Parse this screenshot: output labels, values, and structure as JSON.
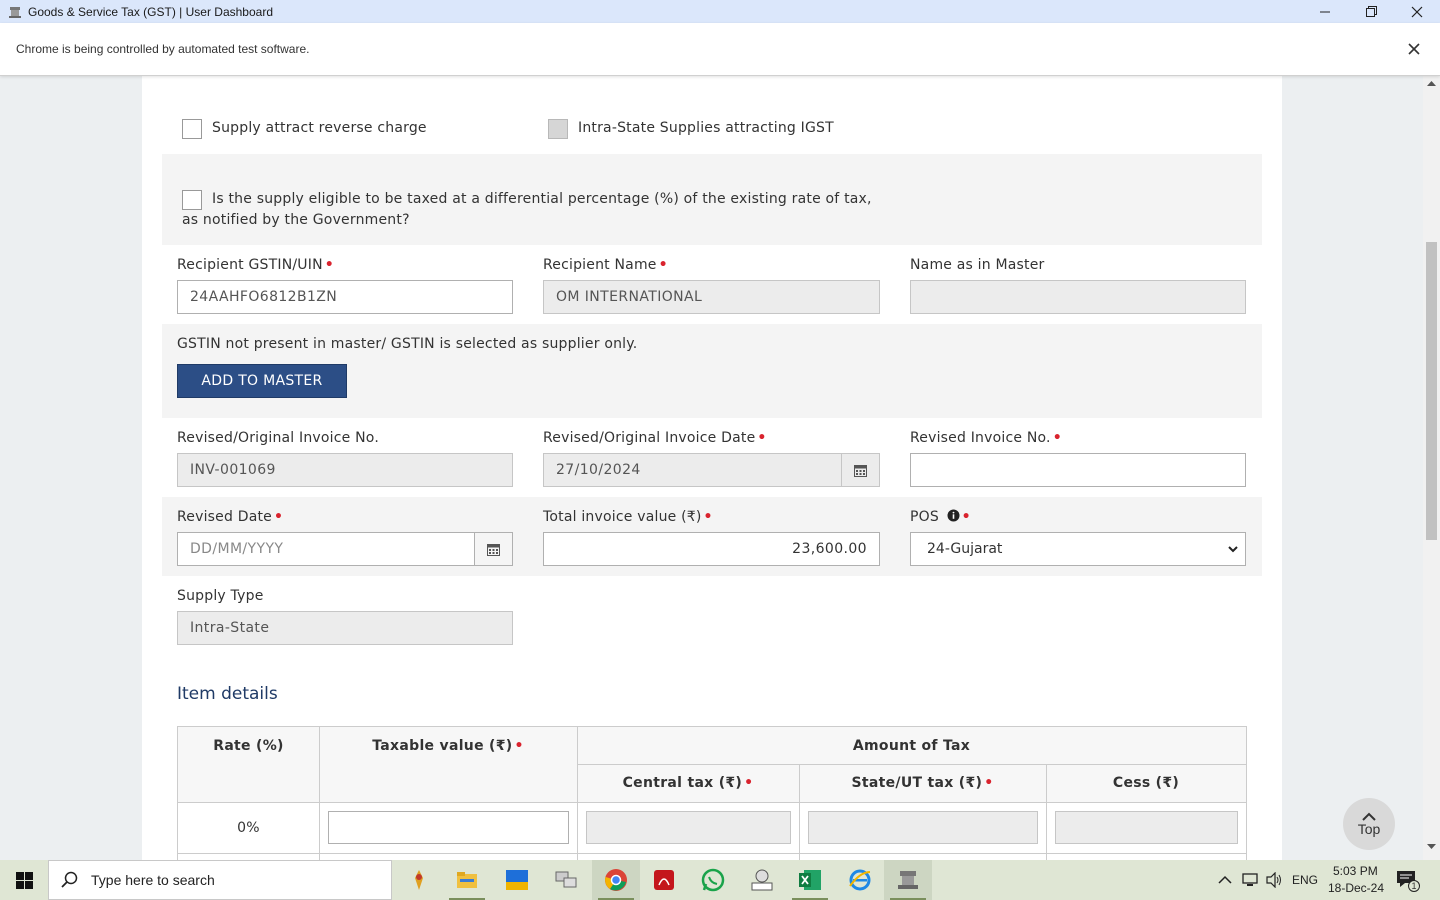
{
  "window": {
    "title": "Goods & Service Tax (GST) | User Dashboard"
  },
  "infobar": {
    "message": "Chrome is being controlled by automated test software."
  },
  "form": {
    "reverse_charge_label": "Supply attract reverse charge",
    "intra_igst_label": "Intra-State Supplies attracting IGST",
    "differential_line1": "Is the supply eligible to be taxed at a differential percentage (%) of the existing rate of tax,",
    "differential_line2": "as notified by the Government?",
    "recipient_gstin_label": "Recipient GSTIN/UIN",
    "recipient_gstin_value": "24AAHFO6812B1ZN",
    "recipient_name_label": "Recipient Name",
    "recipient_name_value": "OM INTERNATIONAL",
    "name_master_label": "Name as in Master",
    "name_master_value": "",
    "gstin_note": "GSTIN not present in master/ GSTIN is selected as supplier only.",
    "add_master_label": "ADD TO MASTER",
    "orig_invoice_no_label": "Revised/Original Invoice No.",
    "orig_invoice_no_value": "INV-001069",
    "orig_invoice_date_label": "Revised/Original Invoice Date",
    "orig_invoice_date_value": "27/10/2024",
    "revised_invoice_no_label": "Revised Invoice No.",
    "revised_invoice_no_value": "",
    "revised_date_label": "Revised Date",
    "revised_date_placeholder": "DD/MM/YYYY",
    "total_value_label": "Total invoice value (₹)",
    "total_value": "23,600.00",
    "pos_label": "POS",
    "pos_value": "24-Gujarat",
    "supply_type_label": "Supply Type",
    "supply_type_value": "Intra-State"
  },
  "items": {
    "section_title": "Item details",
    "headers": {
      "rate": "Rate (%)",
      "taxable": "Taxable value (₹)",
      "amount": "Amount of Tax",
      "central": "Central tax (₹)",
      "state": "State/UT tax (₹)",
      "cess": "Cess (₹)"
    },
    "rows": [
      {
        "rate": "0%"
      }
    ]
  },
  "top_button": "Top",
  "taskbar": {
    "search_placeholder": "Type here to search",
    "lang": "ENG",
    "time": "5:03 PM",
    "date": "18-Dec-24",
    "notification_count": "1"
  }
}
